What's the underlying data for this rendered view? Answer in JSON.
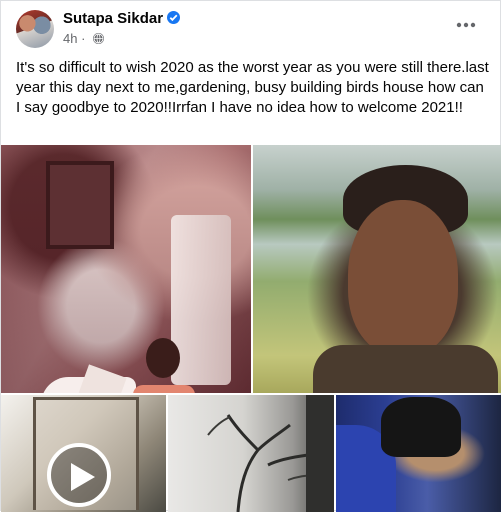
{
  "post": {
    "author": "Sutapa Sikdar",
    "timestamp": "4h",
    "body": "It's so difficult to wish 2020 as the worst year as you were still there.last year this day next to me,gardening, busy building birds house how can I say goodbye to 2020!!Irrfan I have no idea how to welcome 2021!!",
    "photos": [
      {
        "kind": "image"
      },
      {
        "kind": "image"
      },
      {
        "kind": "video"
      },
      {
        "kind": "image"
      },
      {
        "kind": "image"
      }
    ]
  },
  "icons": {
    "verified": "verified-badge-icon",
    "privacy": "globe-icon",
    "more": "more-options-icon",
    "play": "play-icon"
  },
  "colors": {
    "verified": "#1877f2",
    "meta_text": "#65676b",
    "text": "#050505"
  }
}
